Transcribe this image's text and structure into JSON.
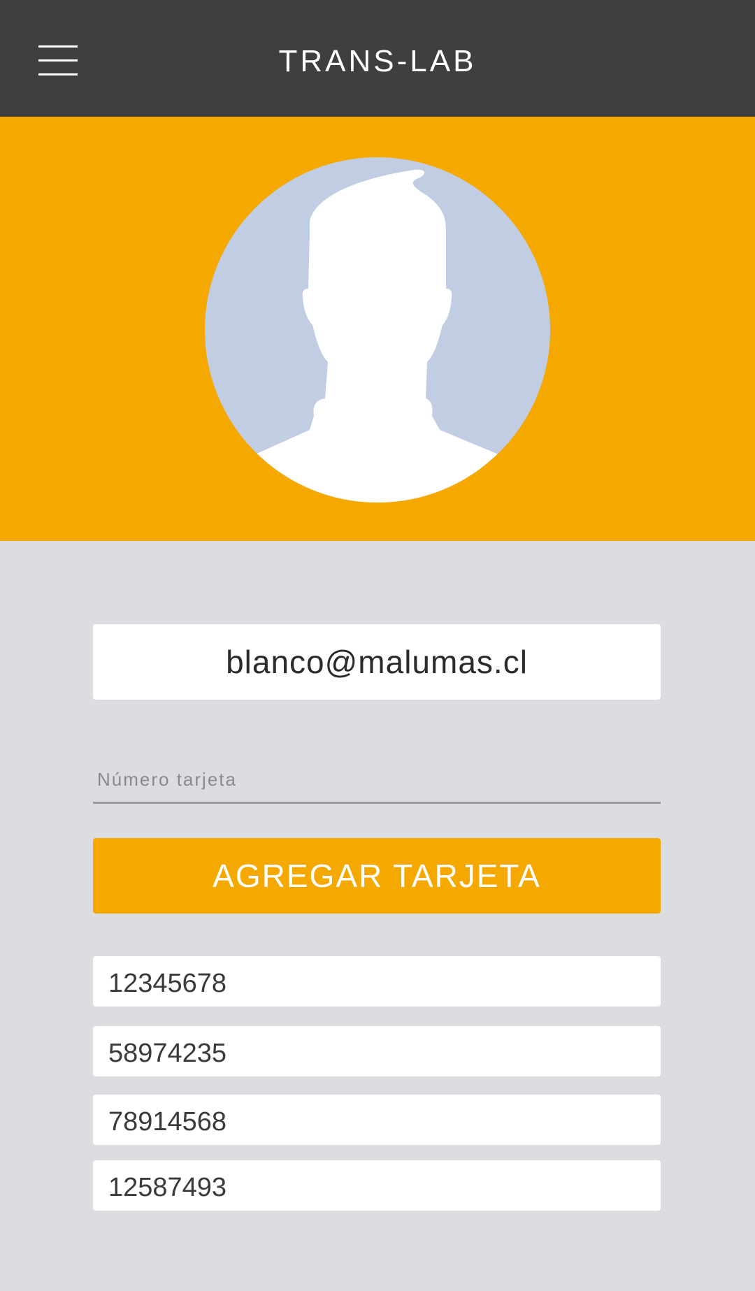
{
  "app_bar": {
    "title": "TRANS-LAB",
    "menu_icon": "hamburger-menu-icon"
  },
  "profile": {
    "avatar_icon": "default-user-avatar-icon"
  },
  "form": {
    "email": "blanco@malumas.cl",
    "card_number_placeholder": "Número tarjeta",
    "add_button_label": "AGREGAR TARJETA"
  },
  "cards": [
    {
      "number": "12345678"
    },
    {
      "number": "58974235"
    },
    {
      "number": "78914568"
    },
    {
      "number": "12587493"
    }
  ],
  "colors": {
    "app_bar": "#3f3f41",
    "accent": "#f5a800",
    "background": "#dcdde0",
    "avatar_bg": "#c1cde2"
  }
}
